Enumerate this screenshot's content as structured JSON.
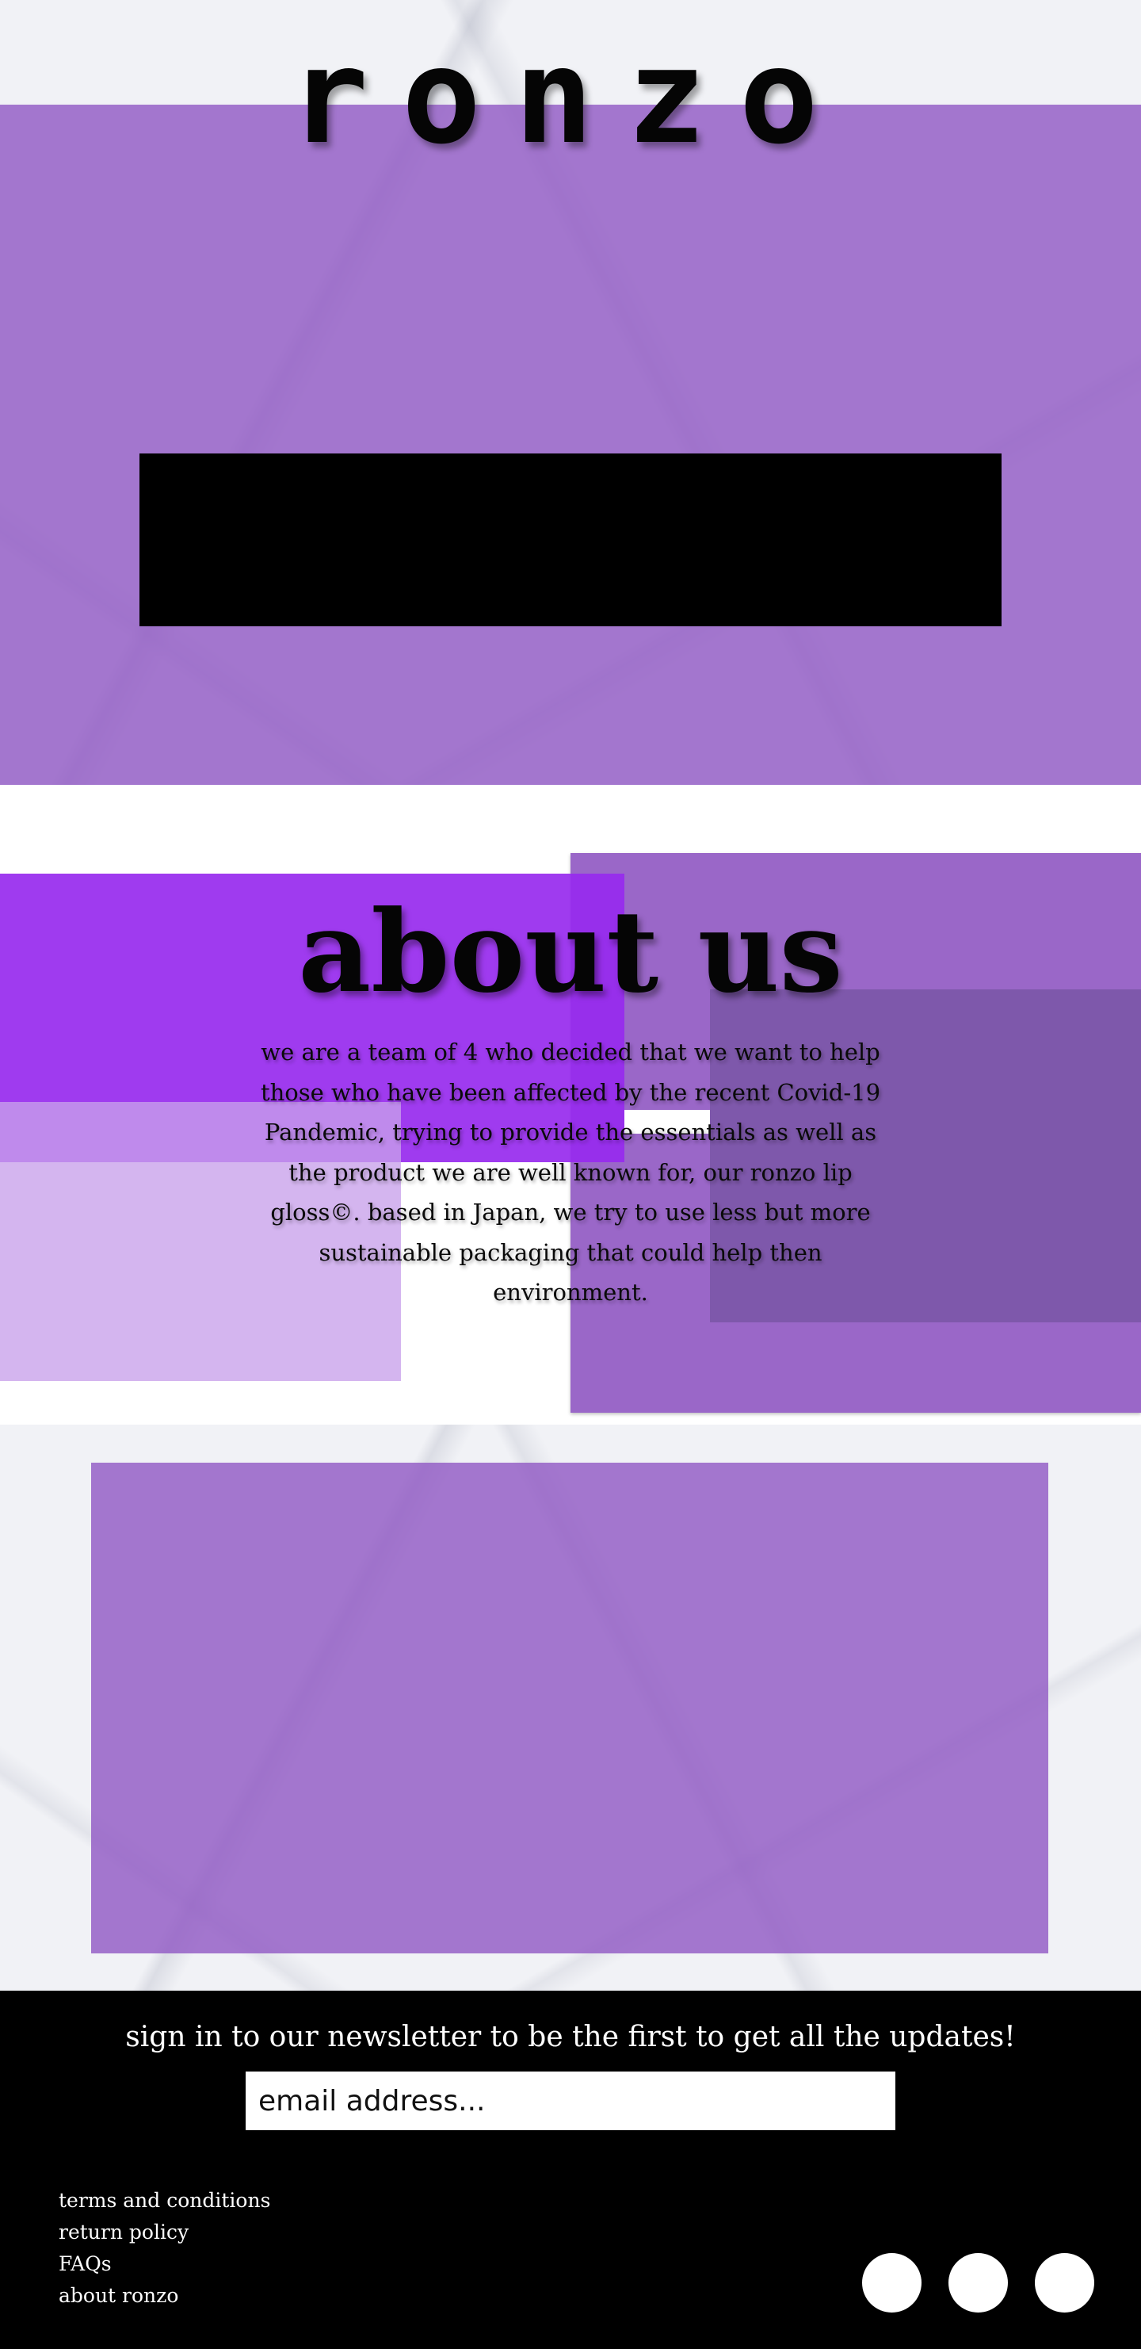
{
  "header": {
    "brand": "ronzo"
  },
  "about": {
    "title": "about us",
    "text": "we are a team of 4 who decided that we want to help those who have been affected by the recent Covid-19 Pandemic, trying to provide the essentials as well as the product we are well known for, our ronzo lip gloss©. based in Japan, we try to use less but more sustainable packaging that could help then environment."
  },
  "newsletter": {
    "title": "sign in to our newsletter to be the first to get all the updates!",
    "placeholder": "email address..."
  },
  "footer": {
    "links": [
      "terms and conditions",
      "return policy",
      "FAQs",
      "about ronzo"
    ]
  },
  "colors": {
    "accent": "#9a67c8",
    "bright_purple": "#972aee",
    "footer_bg": "#000000"
  }
}
